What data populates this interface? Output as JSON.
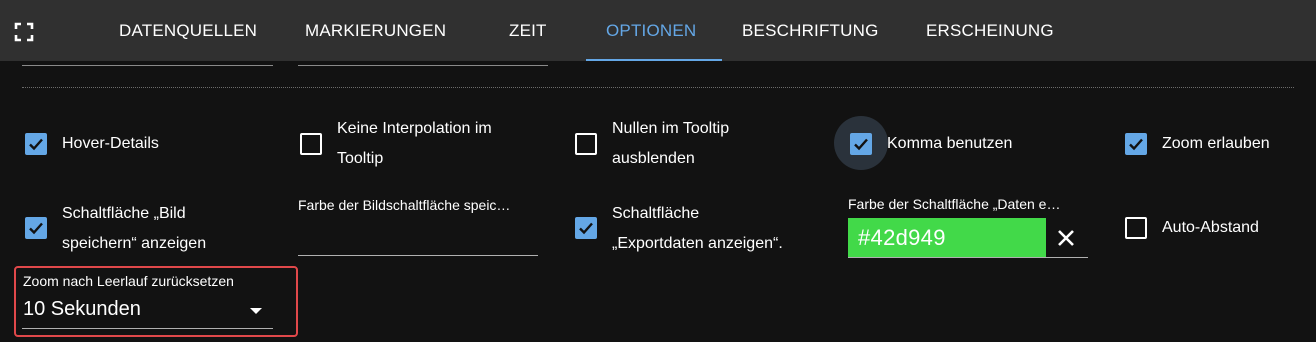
{
  "tabs": [
    {
      "label": "DATENQUELLEN"
    },
    {
      "label": "MARKIERUNGEN"
    },
    {
      "label": "ZEIT"
    },
    {
      "label": "OPTIONEN"
    },
    {
      "label": "BESCHRIFTUNG"
    },
    {
      "label": "ERSCHEINUNG"
    }
  ],
  "active_tab": "OPTIONEN",
  "options": {
    "hover_details": {
      "label": "Hover-Details",
      "checked": true
    },
    "no_interpolation": {
      "label_line1": "Keine Interpolation im",
      "label_line2": "Tooltip",
      "checked": false
    },
    "hide_nulls": {
      "label_line1": "Nullen im Tooltip",
      "label_line2": "ausblenden",
      "checked": false
    },
    "use_comma": {
      "label": "Komma benutzen",
      "checked": true
    },
    "allow_zoom": {
      "label": "Zoom erlauben",
      "checked": true
    },
    "show_save_image": {
      "label_line1": "Schaltfläche „Bild",
      "label_line2": "speichern“ anzeigen",
      "checked": true
    },
    "show_export_data": {
      "label_line1": "Schaltfläche",
      "label_line2": "„Exportdaten anzeigen“.",
      "checked": true
    },
    "auto_spacing": {
      "label": "Auto-Abstand",
      "checked": false
    }
  },
  "fields": {
    "image_button_color": {
      "label": "Farbe der Bildschaltfläche speic…",
      "value": ""
    },
    "data_button_color": {
      "label": "Farbe der Schaltfläche „Daten e…",
      "value": "#42d949"
    },
    "reset_zoom": {
      "label": "Zoom nach Leerlauf zurücksetzen",
      "value": "10 Sekunden"
    }
  },
  "colors": {
    "accent": "#64a7e6",
    "topbar": "#303030",
    "background": "#121212",
    "swatch": "#42d949",
    "highlight": "#e0484a"
  },
  "icons": [
    "fullscreen-icon",
    "check-icon",
    "close-icon",
    "dropdown-arrow-icon"
  ]
}
